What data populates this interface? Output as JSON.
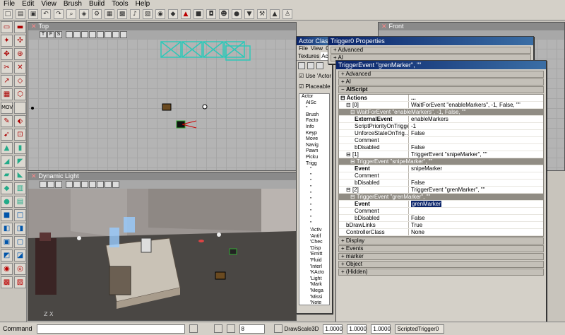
{
  "menu": [
    "File",
    "Edit",
    "View",
    "Brush",
    "Build",
    "Tools",
    "Help"
  ],
  "toolbar_icons": [
    "new-icon",
    "open-icon",
    "save-icon",
    "undo-icon",
    "redo-icon",
    "search-icon",
    "mesh-icon",
    "gear-icon",
    "grid-icon",
    "cube-icon",
    "sound-icon",
    "texture-icon",
    "eye-icon",
    "terrain-icon",
    "triangle-icon",
    "box-icon",
    "camera-icon",
    "actor-icon",
    "sphere-icon",
    "filter-icon",
    "build-icon",
    "play-icon",
    "person-icon"
  ],
  "viewports": {
    "top": {
      "title": "Top",
      "tools": [
        "T",
        "F",
        "S"
      ]
    },
    "front": {
      "title": "Front"
    },
    "dynamic": {
      "title": "Dynamic Light"
    }
  },
  "actor_classes": {
    "title": "Actor Clas",
    "menu": [
      "File",
      "View",
      "O"
    ],
    "tabs": [
      "Textures",
      "Act"
    ],
    "use_actor": "Use 'Actor",
    "placeable": "Placeable",
    "tree": [
      "Actor",
      "AISc",
      "\"",
      "Brush",
      "Facto",
      "Info",
      "Keyp",
      "Move",
      "Navig",
      "Pawn",
      "Picku",
      "Trigg",
      "\"",
      "\"",
      "\"",
      "\"",
      "\"",
      "\"",
      "\"",
      "\"",
      "\"",
      "\"",
      "'Activ",
      "'Antif",
      "'Chec",
      "'Disp",
      "'Emitt",
      "'Fluid",
      "'Interl",
      "'KActo",
      "'Light",
      "'Mark",
      "'Mega",
      "'Missi",
      "'Note"
    ]
  },
  "trigger_props": {
    "title": "Trigger0 Properties",
    "rows": [
      "Advanced",
      "AI"
    ]
  },
  "trigger_event": {
    "title": "TriggerEvent  \"grenMarker\", \"\"",
    "sections_top": [
      "Advanced",
      "AI",
      "AIScript"
    ],
    "actions_label": "Actions",
    "actions_val": "...",
    "item0_label": "[0]",
    "item0_val": "WaitForEvent  \"enableMarkers\", -1, False, \"\"",
    "wait_head": "WaitForEvent  \"enableMarkers\", -1, False, \"\"",
    "wait_rows": [
      {
        "name": "ExternalEvent",
        "value": "enableMarkers",
        "bold": true
      },
      {
        "name": "ScriptPriorityOnTrigger",
        "value": "-1",
        "bold": false
      },
      {
        "name": "UnforceStateOnTrig...",
        "value": "False",
        "bold": false
      },
      {
        "name": "Comment",
        "value": "",
        "bold": false
      },
      {
        "name": "bDisabled",
        "value": "False",
        "bold": false
      }
    ],
    "item1_label": "[1]",
    "item1_val": "TriggerEvent  \"snipeMarker\", \"\"",
    "snipe_head": "TriggerEvent  \"snipeMarker\", \"\"",
    "snipe_rows": [
      {
        "name": "Event",
        "value": "snipeMarker",
        "bold": true
      },
      {
        "name": "Comment",
        "value": "",
        "bold": false
      },
      {
        "name": "bDisabled",
        "value": "False",
        "bold": false
      }
    ],
    "item2_label": "[2]",
    "item2_val": "TriggerEvent  \"grenMarker\", \"\"",
    "gren_head": "TriggerEvent  \"grenMarker\", \"\"",
    "gren_event_name": "Event",
    "gren_event_value": "grenMarker",
    "gren_rows": [
      {
        "name": "Comment",
        "value": "",
        "bold": false
      },
      {
        "name": "bDisabled",
        "value": "False",
        "bold": false
      }
    ],
    "tail_rows": [
      {
        "name": "bDrawLinks",
        "value": "True"
      },
      {
        "name": "ControllerClass",
        "value": "None"
      }
    ],
    "sections_bottom": [
      "Display",
      "Events",
      "marker",
      "Object",
      "(Hidden)"
    ]
  },
  "status": {
    "command_label": "Command",
    "grid_value": "8",
    "drawscale_label": "DrawScale3D",
    "scale_x": "1.0000",
    "scale_y": "1.0000",
    "scale_z": "1.0000",
    "selection": "ScriptedTrigger0"
  },
  "colors": {
    "title_active": "#0a246a",
    "grid": "#b4b4b4",
    "mover": "#3ad0c0"
  }
}
